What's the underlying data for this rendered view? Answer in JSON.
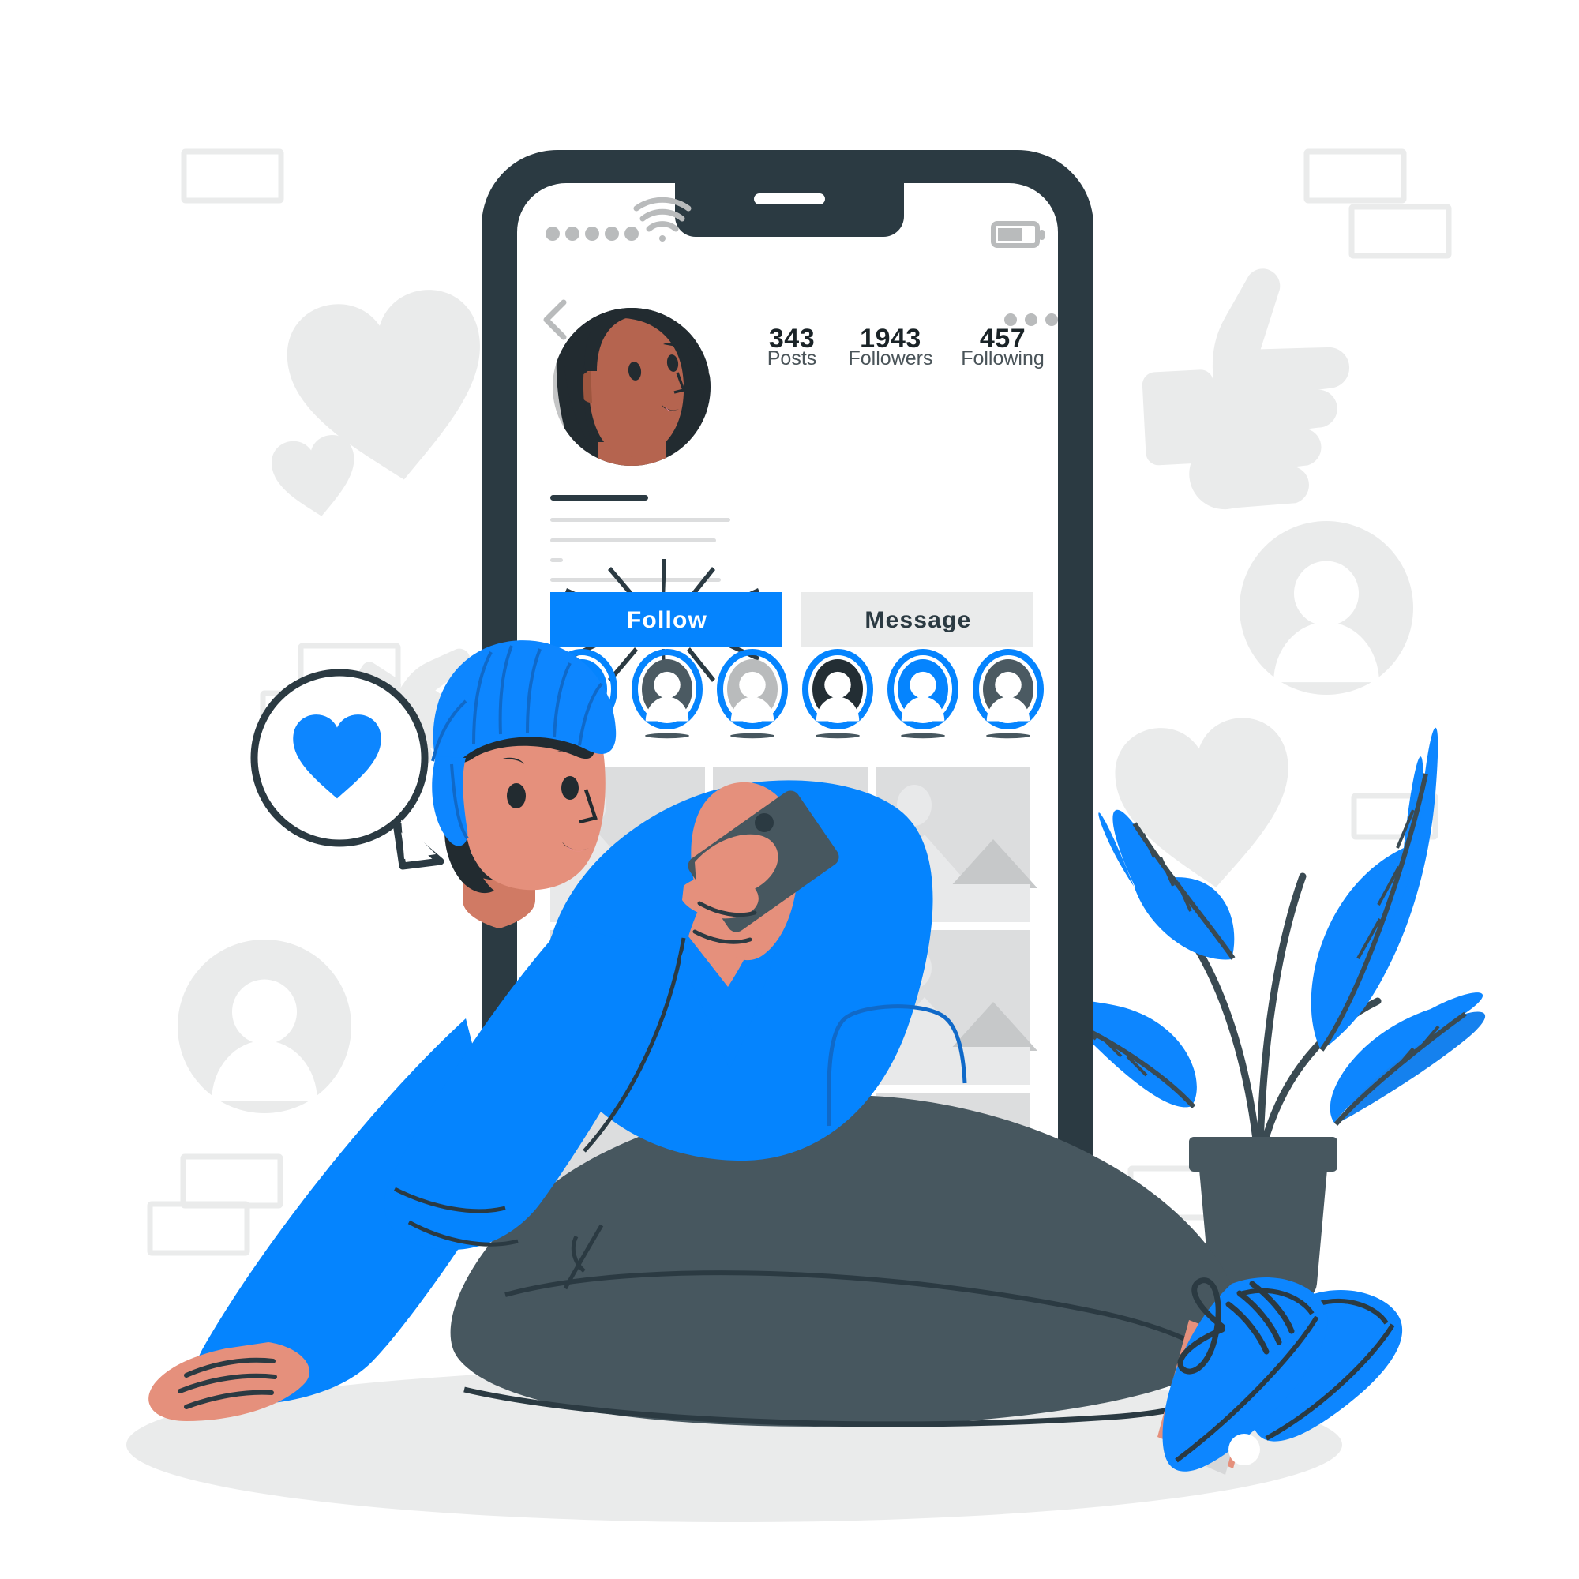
{
  "scene": {
    "title": "Social media profile illustration",
    "description": "A person sitting on the ground holding a smartphone in front of a large phone showing a social profile screen, surrounded by likes, hearts, avatars and a plant"
  },
  "colors": {
    "brand_blue": "#0584FE",
    "blue_deep": "#0a6fd8",
    "dark_navy": "#2B3A42",
    "slate": "#47575F",
    "light_gray": "#EAEBEB",
    "mid_gray": "#D6D7D8",
    "placeholder_gray": "#DCDDDE",
    "skin": "#E5907C",
    "skin_dark": "#B5644F",
    "hair_dark": "#222B30",
    "white": "#FFFFFF",
    "text_dark": "#1a2327"
  },
  "phone": {
    "status_bar": {
      "signal_dots": 5,
      "wifi_icon": "wifi-icon",
      "battery_icon": "battery-icon",
      "battery_level_pct": 55
    },
    "nav": {
      "back_icon": "chevron-left-icon",
      "menu_icon": "more-horizontal-icon"
    },
    "profile": {
      "avatar_name": "profile-avatar",
      "stats": [
        {
          "value": "343",
          "label": "Posts"
        },
        {
          "value": "1943",
          "label": "Followers"
        },
        {
          "value": "457",
          "label": "Following"
        }
      ],
      "bio_lines": 5,
      "buttons": {
        "follow": "Follow",
        "message": "Message"
      },
      "highlights": [
        {
          "fill": "#0584FE"
        },
        {
          "fill": "#4B5A62"
        },
        {
          "fill": "#B9BBBC"
        },
        {
          "fill": "#232E34"
        },
        {
          "fill": "#0584FE"
        },
        {
          "fill": "#4B5A62"
        }
      ],
      "grid_rows": 3,
      "grid_cols": 3
    }
  },
  "decor": {
    "hearts": 3,
    "thumbs_up": 2,
    "avatar_badges": 2,
    "outlined_cards": 9,
    "speech_bubble_icon": "heart-icon",
    "plant": "potted-plant"
  },
  "character": {
    "hat": "beanie-hat",
    "sweater_color": "#0584FE",
    "jeans_color": "#47575F",
    "shoes_color": "#0584FE",
    "holding": "smartphone"
  }
}
